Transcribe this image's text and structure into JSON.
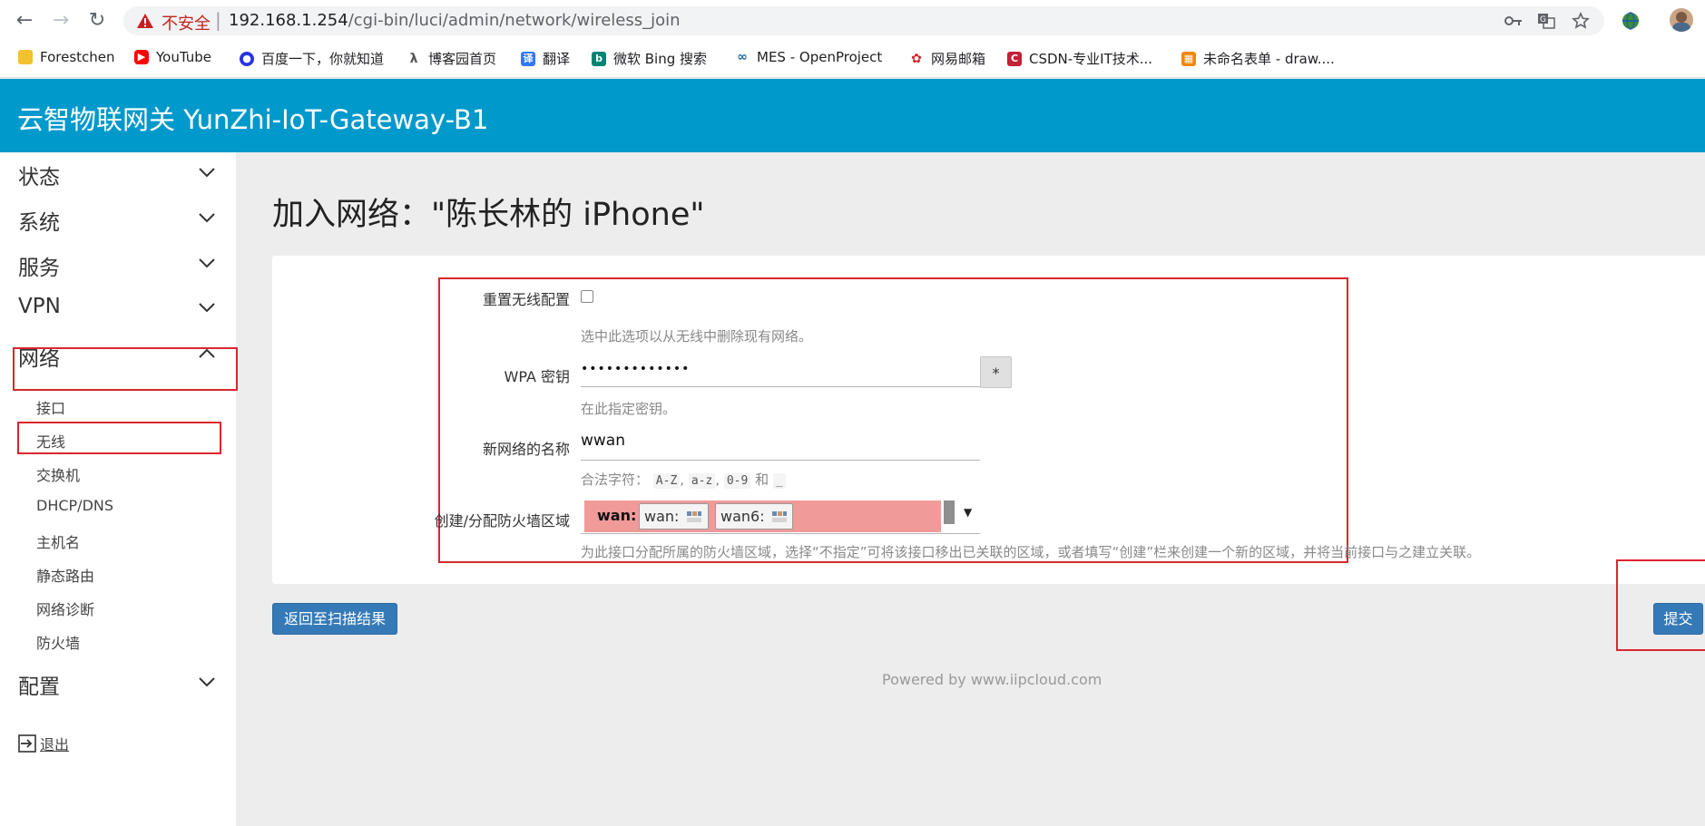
{
  "browser": {
    "insecure_label": "不安全",
    "separator": "|",
    "url_host": "192.168.1.254",
    "url_path": "/cgi-bin/luci/admin/network/wireless_join",
    "bookmarks": [
      {
        "label": "Forestchen",
        "color": "#f2c12e"
      },
      {
        "label": "YouTube",
        "color": "#ff0000"
      },
      {
        "label": "百度一下，你就知道",
        "color": "#2932e1"
      },
      {
        "label": "博客园首页",
        "color": "#555555"
      },
      {
        "label": "翻译",
        "color": "#3478f6"
      },
      {
        "label": "微软 Bing 搜索",
        "color": "#008373"
      },
      {
        "label": "MES - OpenProject",
        "color": "#1a67a3"
      },
      {
        "label": "网易邮箱",
        "color": "#d8232a"
      },
      {
        "label": "CSDN-专业IT技术...",
        "color": "#c32136"
      },
      {
        "label": "未命名表单 - draw....",
        "color": "#f08705"
      }
    ]
  },
  "header": {
    "title": "云智物联网关 YunZhi-IoT-Gateway-B1",
    "color": "#0099cc"
  },
  "sidebar": {
    "menus": [
      {
        "label": "状态"
      },
      {
        "label": "系统"
      },
      {
        "label": "服务"
      },
      {
        "label": "VPN"
      },
      {
        "label": "网络"
      },
      {
        "label": "配置"
      }
    ],
    "network_items": [
      "接口",
      "无线",
      "交换机",
      "DHCP/DNS",
      "主机名",
      "静态路由",
      "网络诊断",
      "防火墙"
    ],
    "logout": "退出",
    "highlight_color": "#d9272f"
  },
  "main": {
    "title": "加入网络：\"陈长林的 iPhone\"",
    "form": {
      "reset_label": "重置无线配置",
      "reset_help": "选中此选项以从无线中删除现有网络。",
      "wpa_label": "WPA 密钥",
      "wpa_value": "•••••••••••••",
      "wpa_reveal": "*",
      "wpa_help": "在此指定密钥。",
      "name_label": "新网络的名称",
      "name_value": "wwan",
      "name_help_prefix": "合法字符：",
      "name_help_c1": "A-Z",
      "name_help_c2": "a-z",
      "name_help_c3": "0-9",
      "name_help_and": "和",
      "name_help_c4": "_",
      "zone_label": "创建/分配防火墙区域",
      "zone_selected": "wan:",
      "zone_chip1": "wan:",
      "zone_chip2": "wan6:",
      "zone_help": "为此接口分配所属的防火墙区域，选择“不指定”可将该接口移出已关联的区域，或者填写“创建”栏来创建一个新的区域，并将当前接口与之建立关联。",
      "zone_color": "#f09a9a"
    },
    "back_button": "返回至扫描结果",
    "submit_button": "提交",
    "button_color": "#357ab7",
    "footer": "Powered by www.iipcloud.com"
  }
}
